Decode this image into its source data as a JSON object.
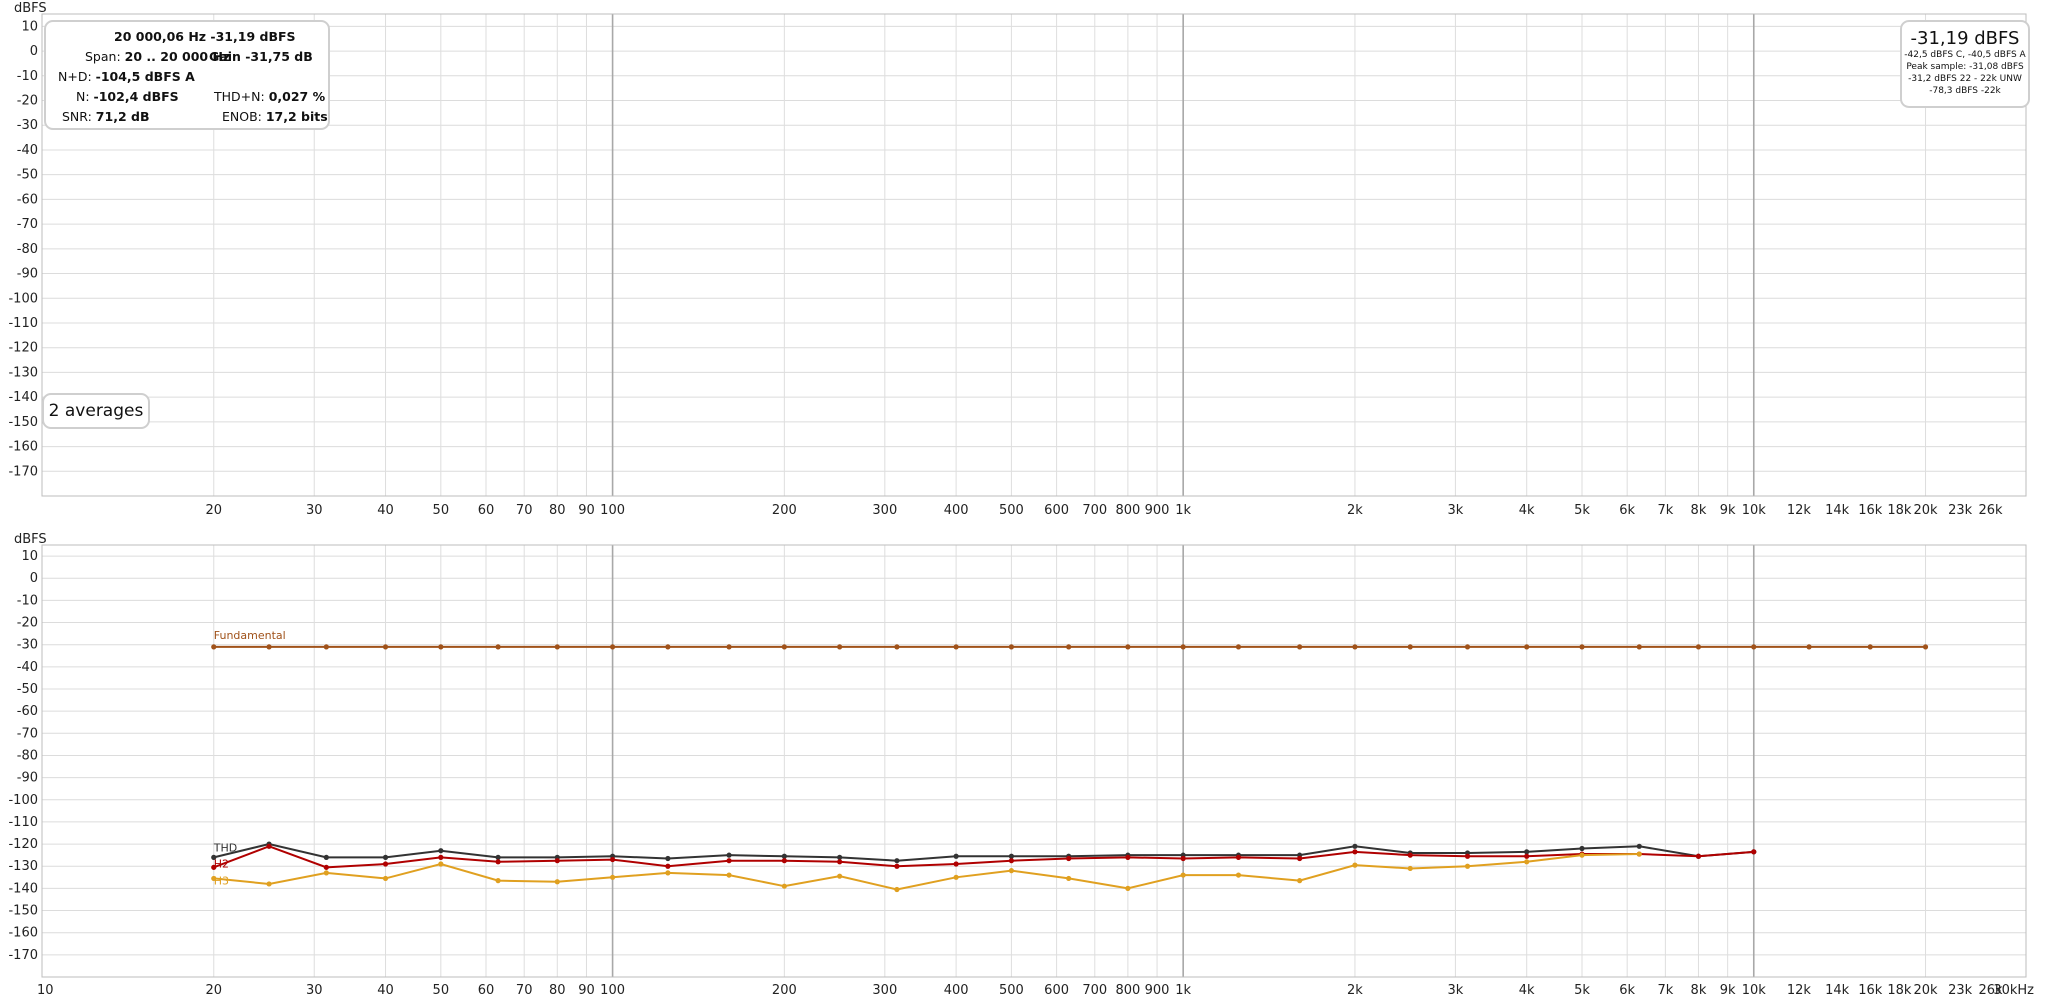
{
  "top_panel": {
    "unit_label": "dBFS",
    "info": {
      "line1": "20 000,06 Hz  -31,19 dBFS",
      "span_label": "Span:",
      "span_value": "20 .. 20 000 Hz",
      "gain": "Gain -31,75 dB",
      "nd_label": "N+D:",
      "nd_value": "-104,5 dBFS A",
      "n_label": "N:",
      "n_value": "-102,4 dBFS",
      "thdn_label": "THD+N:",
      "thdn_value": "0,027 %",
      "snr_label": "SNR:",
      "snr_value": "71,2 dB",
      "enob_label": "ENOB:",
      "enob_value": "17,2 bits"
    },
    "averages": "2 averages",
    "level": {
      "main": "-31,19 dBFS",
      "line1": "-42,5 dBFS C, -40,5 dBFS A",
      "line2": "Peak sample: -31,08 dBFS",
      "line3": "-31,2 dBFS 22 - 22k UNW",
      "line4": "-78,3 dBFS -22k"
    }
  },
  "bottom_panel": {
    "unit_label": "dBFS",
    "x_unit": "Hz"
  },
  "axis": {
    "y_ticks": [
      "10",
      "0",
      "-10",
      "-20",
      "-30",
      "-40",
      "-50",
      "-60",
      "-70",
      "-80",
      "-90",
      "-100",
      "-110",
      "-120",
      "-130",
      "-140",
      "-150",
      "-160",
      "-170"
    ],
    "top_x_ticks": [
      {
        "f": 20,
        "t": "20"
      },
      {
        "f": 30,
        "t": "30"
      },
      {
        "f": 40,
        "t": "40"
      },
      {
        "f": 50,
        "t": "50"
      },
      {
        "f": 60,
        "t": "60"
      },
      {
        "f": 70,
        "t": "70"
      },
      {
        "f": 80,
        "t": "80"
      },
      {
        "f": 90,
        "t": "90"
      },
      {
        "f": 100,
        "t": "100"
      },
      {
        "f": 200,
        "t": "200"
      },
      {
        "f": 300,
        "t": "300"
      },
      {
        "f": 400,
        "t": "400"
      },
      {
        "f": 500,
        "t": "500"
      },
      {
        "f": 600,
        "t": "600"
      },
      {
        "f": 700,
        "t": "700"
      },
      {
        "f": 800,
        "t": "800"
      },
      {
        "f": 900,
        "t": "900"
      },
      {
        "f": 1000,
        "t": "1k"
      },
      {
        "f": 2000,
        "t": "2k"
      },
      {
        "f": 3000,
        "t": "3k"
      },
      {
        "f": 4000,
        "t": "4k"
      },
      {
        "f": 5000,
        "t": "5k"
      },
      {
        "f": 6000,
        "t": "6k"
      },
      {
        "f": 7000,
        "t": "7k"
      },
      {
        "f": 8000,
        "t": "8k"
      },
      {
        "f": 9000,
        "t": "9k"
      },
      {
        "f": 10000,
        "t": "10k"
      },
      {
        "f": 12000,
        "t": "12k"
      },
      {
        "f": 14000,
        "t": "14k"
      },
      {
        "f": 16000,
        "t": "16k"
      },
      {
        "f": 18000,
        "t": "18k"
      },
      {
        "f": 20000,
        "t": "20k"
      },
      {
        "f": 23000,
        "t": "23k"
      },
      {
        "f": 26000,
        "t": "26k"
      }
    ],
    "bottom_x_ticks": [
      {
        "f": 10,
        "t": "10"
      },
      {
        "f": 20,
        "t": "20"
      },
      {
        "f": 30,
        "t": "30"
      },
      {
        "f": 40,
        "t": "40"
      },
      {
        "f": 50,
        "t": "50"
      },
      {
        "f": 60,
        "t": "60"
      },
      {
        "f": 70,
        "t": "70"
      },
      {
        "f": 80,
        "t": "80"
      },
      {
        "f": 90,
        "t": "90"
      },
      {
        "f": 100,
        "t": "100"
      },
      {
        "f": 200,
        "t": "200"
      },
      {
        "f": 300,
        "t": "300"
      },
      {
        "f": 400,
        "t": "400"
      },
      {
        "f": 500,
        "t": "500"
      },
      {
        "f": 600,
        "t": "600"
      },
      {
        "f": 700,
        "t": "700"
      },
      {
        "f": 800,
        "t": "800"
      },
      {
        "f": 900,
        "t": "900"
      },
      {
        "f": 1000,
        "t": "1k"
      },
      {
        "f": 2000,
        "t": "2k"
      },
      {
        "f": 3000,
        "t": "3k"
      },
      {
        "f": 4000,
        "t": "4k"
      },
      {
        "f": 5000,
        "t": "5k"
      },
      {
        "f": 6000,
        "t": "6k"
      },
      {
        "f": 7000,
        "t": "7k"
      },
      {
        "f": 8000,
        "t": "8k"
      },
      {
        "f": 9000,
        "t": "9k"
      },
      {
        "f": 10000,
        "t": "10k"
      },
      {
        "f": 12000,
        "t": "12k"
      },
      {
        "f": 14000,
        "t": "14k"
      },
      {
        "f": 16000,
        "t": "16k"
      },
      {
        "f": 18000,
        "t": "18k"
      },
      {
        "f": 20000,
        "t": "20k"
      },
      {
        "f": 23000,
        "t": "23k"
      },
      {
        "f": 26000,
        "t": "26k"
      },
      {
        "f": 30000,
        "t": "30kHz"
      }
    ]
  },
  "chart_data": {
    "type": "line",
    "x_scale": "log",
    "xlim": [
      10,
      30000
    ],
    "ylim": [
      -180,
      15
    ],
    "xlabel": "Hz",
    "ylabel": "dBFS",
    "grid": true,
    "series": [
      {
        "name": "Fundamental",
        "color": "#a0521a",
        "x": [
          20,
          25,
          31.5,
          40,
          50,
          63,
          80,
          100,
          125,
          160,
          200,
          250,
          315,
          400,
          500,
          630,
          800,
          1000,
          1250,
          1600,
          2000,
          2500,
          3150,
          4000,
          5000,
          6300,
          8000,
          10000,
          12500,
          16000,
          20000
        ],
        "y": [
          -31,
          -31,
          -31,
          -31,
          -31,
          -31,
          -31,
          -31,
          -31,
          -31,
          -31,
          -31,
          -31,
          -31,
          -31,
          -31,
          -31,
          -31,
          -31,
          -31,
          -31,
          -31,
          -31,
          -31,
          -31,
          -31,
          -31,
          -31,
          -31,
          -31,
          -31
        ]
      },
      {
        "name": "THD",
        "color": "#333333",
        "x": [
          20,
          25,
          31.5,
          40,
          50,
          63,
          80,
          100,
          125,
          160,
          200,
          250,
          315,
          400,
          500,
          630,
          800,
          1000,
          1250,
          1600,
          2000,
          2500,
          3150,
          4000,
          5000,
          6300,
          8000,
          10000
        ],
        "y": [
          -126,
          -120,
          -126,
          -126,
          -123,
          -126,
          -126,
          -125.5,
          -126.5,
          -125,
          -125.5,
          -126,
          -127.5,
          -125.5,
          -125.5,
          -125.5,
          -125,
          -125,
          -125,
          -125,
          -121,
          -124,
          -124,
          -123.5,
          -122,
          -121,
          -125.5,
          -123.5
        ]
      },
      {
        "name": "H2",
        "color": "#b00000",
        "x": [
          20,
          25,
          31.5,
          40,
          50,
          63,
          80,
          100,
          125,
          160,
          200,
          250,
          315,
          400,
          500,
          630,
          800,
          1000,
          1250,
          1600,
          2000,
          2500,
          3150,
          4000,
          5000,
          6300,
          8000,
          10000
        ],
        "y": [
          -130.5,
          -121,
          -130.5,
          -129,
          -126,
          -128,
          -127.5,
          -127,
          -130,
          -127.5,
          -127.5,
          -128,
          -130,
          -129,
          -127.5,
          -126.5,
          -126,
          -126.5,
          -126,
          -126.5,
          -123.5,
          -125,
          -125.5,
          -125.5,
          -124.5,
          -124.5,
          -125.5,
          -123.5
        ]
      },
      {
        "name": "H3",
        "color": "#e0a020",
        "x": [
          20,
          25,
          31.5,
          40,
          50,
          63,
          80,
          100,
          125,
          160,
          200,
          250,
          315,
          400,
          500,
          630,
          800,
          1000,
          1250,
          1600,
          2000,
          2500,
          3150,
          4000,
          5000,
          6300
        ],
        "y": [
          -135.5,
          -138,
          -133,
          -135.5,
          -129,
          -136.5,
          -137,
          -135,
          -133,
          -134,
          -139,
          -134.5,
          -140.5,
          -135,
          -132,
          -135.5,
          -140,
          -134,
          -134,
          -136.5,
          -129.5,
          -131,
          -130,
          -128,
          -125,
          -124.5
        ]
      }
    ]
  }
}
